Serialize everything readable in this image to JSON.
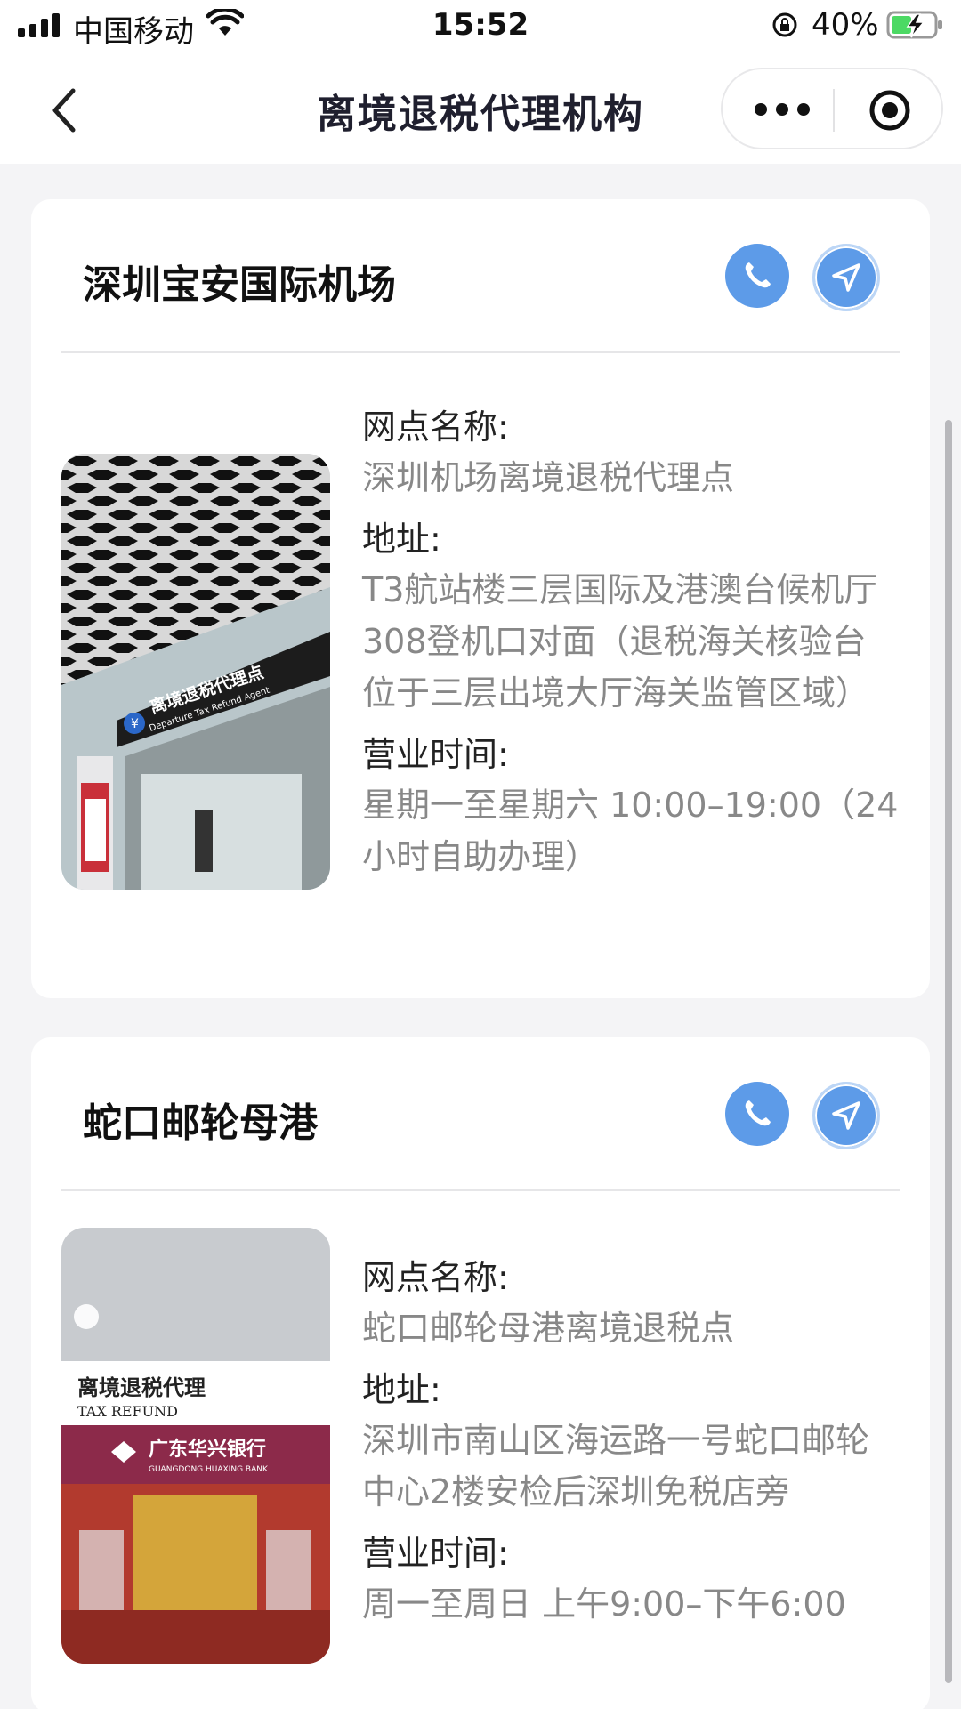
{
  "status_bar": {
    "carrier": "中国移动",
    "time": "15:52",
    "battery_percent": "40%"
  },
  "nav": {
    "title": "离境退税代理机构"
  },
  "labels": {
    "outlet_name": "网点名称:",
    "address": "地址:",
    "hours": "营业时间:"
  },
  "locations": [
    {
      "title": "深圳宝安国际机场",
      "outlet_name": "深圳机场离境退税代理点",
      "address": "T3航站楼三层国际及港澳台候机厅308登机口对面（退税海关核验台位于三层出境大厅海关监管区域）",
      "hours": "星期一至星期六 10:00–19:00（24小时自助办理）",
      "photo_sign_cn": "离境退税代理点",
      "photo_sign_en": "Departure Tax Refund Agent"
    },
    {
      "title": "蛇口邮轮母港",
      "outlet_name": "蛇口邮轮母港离境退税点",
      "address": "深圳市南山区海运路一号蛇口邮轮中心2楼安检后深圳免税店旁",
      "hours": "周一至周日 上午9:00–下午6:00",
      "photo_sign_cn": "离境退税代理",
      "photo_sign_en": "TAX REFUND",
      "photo_bank_cn": "广东华兴银行",
      "photo_bank_en": "GUANGDONG HUAXING BANK"
    }
  ],
  "colors": {
    "accent_button": "#5d9be8",
    "page_background": "#f4f4f6",
    "value_text": "#888888"
  },
  "icons": [
    "signal-icon",
    "wifi-icon",
    "orientation-lock-icon",
    "battery-charging-icon",
    "back-chevron-icon",
    "more-dots-icon",
    "close-circle-icon",
    "phone-icon",
    "navigation-arrow-icon"
  ]
}
